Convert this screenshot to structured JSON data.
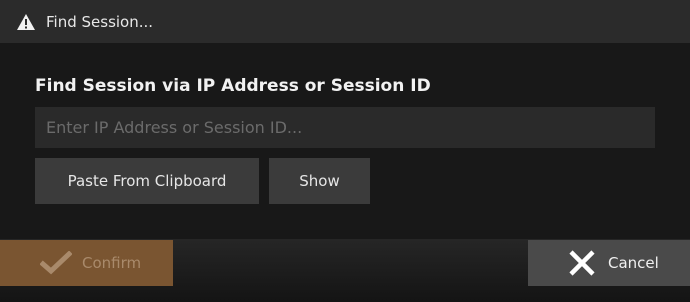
{
  "titlebar": {
    "title": "Find Session...",
    "icon": "warning-icon"
  },
  "main": {
    "heading": "Find Session via IP Address or Session ID",
    "input": {
      "placeholder": "Enter IP Address or Session ID...",
      "value": ""
    },
    "paste_label": "Paste From Clipboard",
    "show_label": "Show"
  },
  "footer": {
    "confirm_label": "Confirm",
    "confirm_icon": "checkmark-icon",
    "cancel_label": "Cancel",
    "cancel_icon": "close-icon"
  },
  "colors": {
    "confirm_bg": "#7a5531",
    "cancel_bg": "#4a4a4a",
    "titlebar_bg": "#2b2b2b"
  }
}
